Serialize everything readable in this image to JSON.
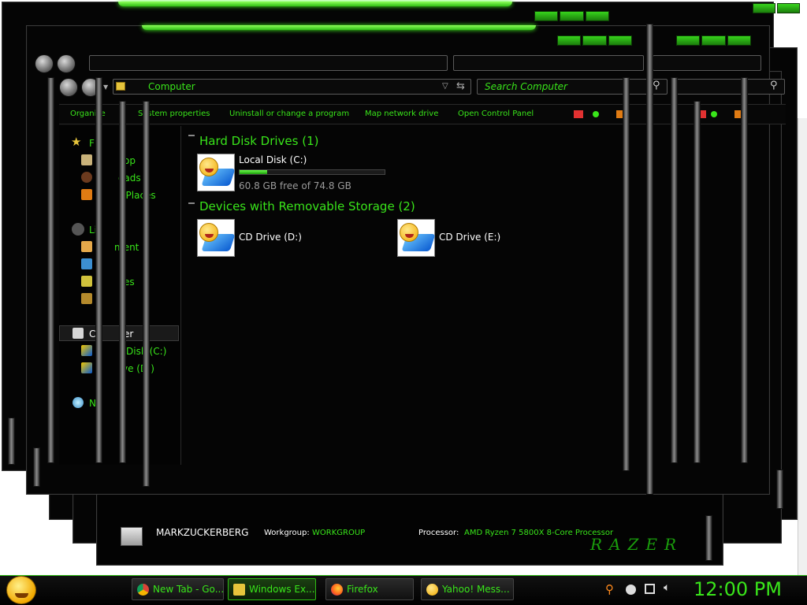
{
  "window": {
    "address": "Computer",
    "search_placeholder": "Search Computer"
  },
  "commandbar": {
    "organize": "Organize",
    "system_properties": "System properties",
    "uninstall": "Uninstall or change a program",
    "map_drive": "Map network drive",
    "control_panel": "Open Control Panel"
  },
  "sidebar": {
    "favorites_frag": "F",
    "fav1_frag": "op",
    "fav2_frag": "oads",
    "fav3_frag": "t Places",
    "libraries_frag": "Li",
    "lib1_frag": "ment",
    "lib3_frag": "es",
    "computer_frag": "C",
    "computer_frag2": "er",
    "local_frag": "Disk (C:)",
    "cd_frag": "ve (D:)",
    "network_frag": "N"
  },
  "content": {
    "group_hdd": "Hard Disk Drives (1)",
    "local_disk_name": "Local Disk (C:)",
    "local_disk_usage_fraction": 0.19,
    "local_disk_free": "60.8 GB free of 74.8 GB",
    "group_removable": "Devices with Removable Storage (2)",
    "cd_d": "CD Drive (D:)",
    "cd_e": "CD Drive (E:)"
  },
  "details": {
    "computer_name": "MARKZUCKERBERG",
    "workgroup_label": "Workgroup:",
    "workgroup_value": "WORKGROUP",
    "processor_label": "Processor:",
    "processor_value": "AMD Ryzen 7 5800X 8-Core Processor",
    "brand": "RAZER"
  },
  "taskbar": {
    "items": [
      {
        "label": "New Tab - Go..."
      },
      {
        "label": "Windows Ex..."
      },
      {
        "label": "Firefox"
      },
      {
        "label": "Yahoo! Mess..."
      }
    ],
    "clock": "12:00 PM"
  },
  "colors": {
    "accent": "#39e51a",
    "background": "#050505"
  }
}
